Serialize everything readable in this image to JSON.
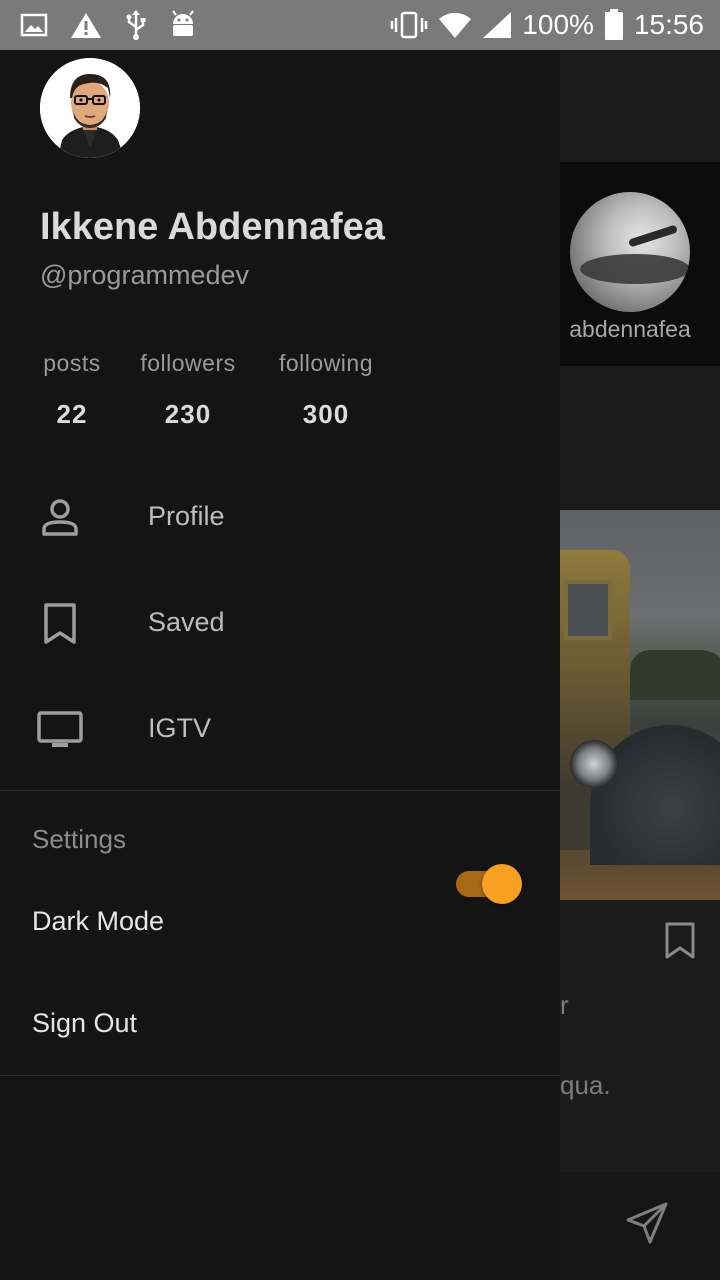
{
  "status_bar": {
    "battery": "100%",
    "time": "15:56",
    "left_icons": [
      "image-icon",
      "warning-icon",
      "usb-icon",
      "android-icon"
    ],
    "right_icons": [
      "vibrate-icon",
      "wifi-icon",
      "signal-icon",
      "battery-icon"
    ]
  },
  "drawer": {
    "name": "Ikkene Abdennafea",
    "handle": "@programmedev",
    "stats": [
      {
        "label": "posts",
        "value": "22"
      },
      {
        "label": "followers",
        "value": "230"
      },
      {
        "label": "following",
        "value": "300"
      }
    ],
    "menu": [
      {
        "label": "Profile",
        "icon": "person-icon"
      },
      {
        "label": "Saved",
        "icon": "bookmark-icon"
      },
      {
        "label": "IGTV",
        "icon": "tv-icon"
      }
    ],
    "settings_header": "Settings",
    "dark_mode_label": "Dark Mode",
    "dark_mode_on": true,
    "sign_out_label": "Sign Out"
  },
  "background": {
    "story_username": "abdennafea",
    "peek_text_1": "r",
    "peek_text_2": "qua."
  },
  "colors": {
    "accent": "#f7a021",
    "drawer_bg": "#141414",
    "status_bar_bg": "#7a7a7a"
  }
}
